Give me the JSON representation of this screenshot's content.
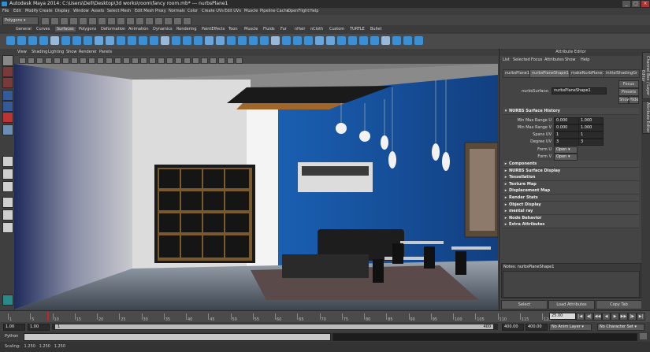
{
  "window": {
    "title": "Autodesk Maya 2014: C:\\Users\\Dell\\Desktop\\3d works\\room\\fancy room.mb* --- nurbsPlane1",
    "controls": [
      "_",
      "□",
      "×"
    ]
  },
  "menubar": [
    "File",
    "Edit",
    "Modify",
    "Create",
    "Display",
    "Window",
    "Assets",
    "Select",
    "Mesh",
    "Edit Mesh",
    "Proxy",
    "Normals",
    "Color",
    "Create UVs",
    "Edit UVs",
    "Muscle",
    "Pipeline Cache",
    "OpenFlight",
    "Help"
  ],
  "status_line": {
    "menu_set": "Polygons"
  },
  "shelf_tabs": [
    "General",
    "Curves",
    "Surfaces",
    "Polygons",
    "Deformation",
    "Animation",
    "Dynamics",
    "Rendering",
    "PaintEffects",
    "Toon",
    "Muscle",
    "Fluids",
    "Fur",
    "nHair",
    "nCloth",
    "Custom",
    "TURTLE",
    "Bullet"
  ],
  "shelf_active": "Surfaces",
  "viewport_menu": [
    "View",
    "Shading",
    "Lighting",
    "Show",
    "Renderer",
    "Panels"
  ],
  "attribute_editor": {
    "title": "Attribute Editor",
    "menu": [
      "List",
      "Selected",
      "Focus",
      "Attributes",
      "Show",
      "Help"
    ],
    "tabs": [
      "nurbsPlane1",
      "nurbsPlaneShape1",
      "makeNurbPlane1",
      "initialShadingGr"
    ],
    "active_tab": "nurbsPlaneShape1",
    "node_label": "nurbsSurface:",
    "node_value": "nurbsPlaneShape1",
    "focus_button": "Focus",
    "presets_button": "Presets",
    "show_button": "Show",
    "hide_button": "Hide",
    "history_section": "NURBS Surface History",
    "fields": [
      {
        "label": "Min Max Range U",
        "v1": "0.000",
        "v2": "1.000"
      },
      {
        "label": "Min Max Range V",
        "v1": "0.000",
        "v2": "1.000"
      },
      {
        "label": "Spans UV",
        "v1": "1",
        "v2": "1"
      },
      {
        "label": "Degree UV",
        "v1": "3",
        "v2": "3"
      }
    ],
    "form_u_label": "Form U",
    "form_u_value": "Open",
    "form_v_label": "Form V",
    "form_v_value": "Open",
    "sections": [
      "Components",
      "NURBS Surface Display",
      "Tessellation",
      "Texture Map",
      "Displacement Map",
      "Render Stats",
      "Object Display",
      "mental ray",
      "Node Behavior",
      "Extra Attributes"
    ],
    "notes_label": "Notes: nurbsPlaneShape1",
    "bottom_buttons": [
      "Select",
      "Load Attributes",
      "Copy Tab"
    ]
  },
  "side_tabs": [
    "Channel Box / Layer Editor",
    "Attribute Editor"
  ],
  "time_slider": {
    "labels": [
      "1",
      "5",
      "10",
      "15",
      "20",
      "25",
      "30",
      "35",
      "40",
      "45",
      "50",
      "55",
      "60",
      "65",
      "70",
      "75",
      "80",
      "85",
      "90",
      "95",
      "100",
      "105",
      "110",
      "115",
      "120"
    ],
    "current_frame": "25.00"
  },
  "range_slider": {
    "start": "1.00",
    "playback_start": "1.00",
    "range_start_label": "1",
    "range_end_label": "400",
    "playback_end": "400.00",
    "end": "400.00",
    "anim_layer": "No Anim Layer",
    "char_set": "No Character Set"
  },
  "command_line": {
    "label": "Python"
  },
  "help_line": {
    "text": "Scaling:   1.250   1.250   1.250"
  },
  "colors": {
    "ui_bg": "#444444",
    "wall_blue": "#1f5aa8",
    "accent_blue": "#2f8fd0"
  }
}
